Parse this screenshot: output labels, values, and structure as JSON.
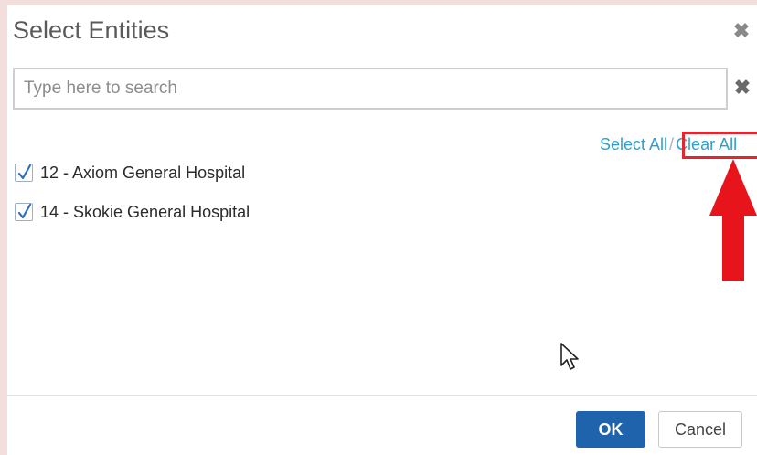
{
  "dialog": {
    "title": "Select Entities",
    "close_icon": "close-icon"
  },
  "search": {
    "placeholder": "Type here to search",
    "value": "",
    "clear_icon": "close-icon"
  },
  "actions": {
    "select_all": "Select All",
    "separator": "/",
    "clear_all": "Clear All"
  },
  "entities": [
    {
      "label": "12 - Axiom General Hospital",
      "checked": true
    },
    {
      "label": "14 - Skokie General Hospital",
      "checked": true
    }
  ],
  "footer": {
    "ok_label": "OK",
    "cancel_label": "Cancel"
  },
  "colors": {
    "accent": "#2e9fd0",
    "primary_button": "#1f63ad",
    "highlight": "#e0282e"
  }
}
